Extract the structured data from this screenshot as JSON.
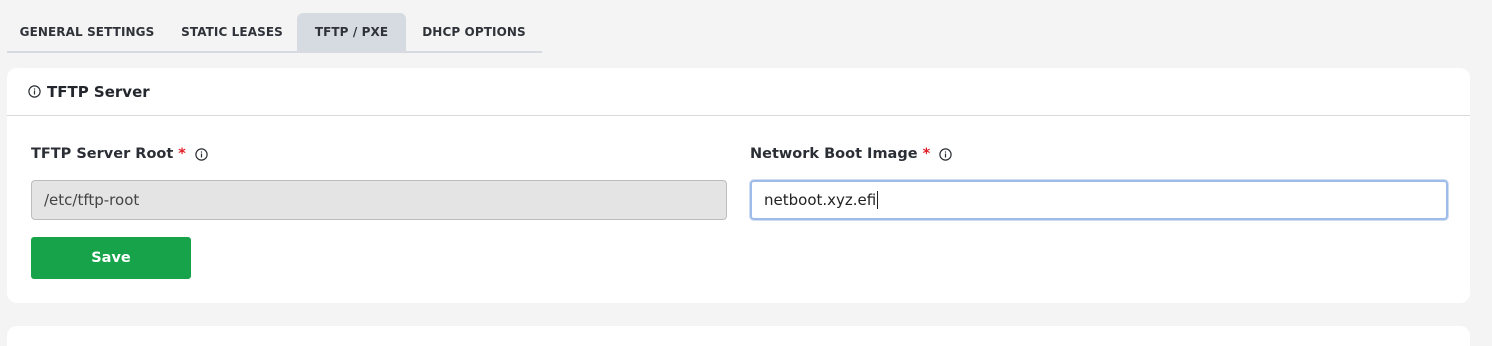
{
  "tabs": [
    {
      "label": "GENERAL SETTINGS",
      "active": false
    },
    {
      "label": "STATIC LEASES",
      "active": false
    },
    {
      "label": "TFTP / PXE",
      "active": true
    },
    {
      "label": "DHCP OPTIONS",
      "active": false
    }
  ],
  "section": {
    "title": "TFTP Server",
    "icon": "info-icon"
  },
  "fields": {
    "tftp_root": {
      "label": "TFTP Server Root",
      "required_mark": "*",
      "value": "/etc/tftp-root",
      "readonly": true
    },
    "boot_image": {
      "label": "Network Boot Image",
      "required_mark": "*",
      "value": "netboot.xyz.efi",
      "focused": true
    }
  },
  "actions": {
    "save_label": "Save"
  },
  "colors": {
    "primary_button": "#16a34a",
    "required": "#e01b24",
    "active_tab_bg": "#d6dbe2",
    "focus_border": "#9ebcea"
  }
}
